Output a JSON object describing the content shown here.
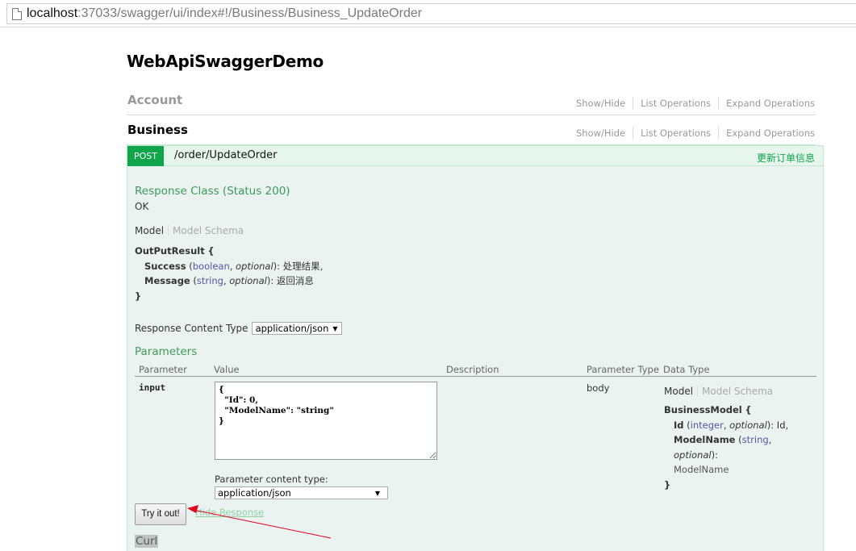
{
  "browser": {
    "url_host": "localhost",
    "url_rest": ":37033/swagger/ui/index#!/Business/Business_UpdateOrder"
  },
  "api": {
    "title": "WebApiSwaggerDemo"
  },
  "resources": [
    {
      "name": "Account",
      "links": [
        "Show/Hide",
        "List Operations",
        "Expand Operations"
      ]
    },
    {
      "name": "Business",
      "links": [
        "Show/Hide",
        "List Operations",
        "Expand Operations"
      ]
    }
  ],
  "operation": {
    "method": "POST",
    "path": "/order/UpdateOrder",
    "summary": "更新订单信息",
    "method_color": "#10a54a",
    "response_class_label": "Response Class (Status 200)",
    "response_class_value": "OK",
    "model_tabs": {
      "model": "Model",
      "schema": "Model Schema"
    },
    "response_model": {
      "name": "OutPutResult",
      "open": "{",
      "close": "}",
      "properties": [
        {
          "name": "Success",
          "type": "boolean",
          "optional": "optional",
          "description": "处理结果",
          "suffix": ","
        },
        {
          "name": "Message",
          "type": "string",
          "optional": "optional",
          "description": "返回消息",
          "suffix": ""
        }
      ]
    },
    "response_content_type_label": "Response Content Type",
    "response_content_type": "application/json",
    "parameters_label": "Parameters",
    "parameter_columns": [
      "Parameter",
      "Value",
      "Description",
      "Parameter Type",
      "Data Type"
    ],
    "parameters": [
      {
        "name": "input",
        "value": "{\n  \"Id\": 0,\n  \"ModelName\": \"string\"\n}",
        "description": "",
        "parameter_type": "body",
        "data_type_model": {
          "name": "BusinessModel",
          "open": "{",
          "close": "}",
          "properties": [
            {
              "name": "Id",
              "type": "integer",
              "optional": "optional",
              "description": "Id",
              "suffix": ","
            },
            {
              "name": "ModelName",
              "type": "string",
              "optional": "optional",
              "description": "ModelName",
              "suffix": ""
            }
          ]
        }
      }
    ],
    "parameter_content_type_label": "Parameter content type:",
    "parameter_content_type": "application/json",
    "try_button": "Try it out!",
    "hide_response": "Hide Response",
    "curl_label": "Curl"
  },
  "annotation": {
    "arrow_color": "#e0001a"
  }
}
